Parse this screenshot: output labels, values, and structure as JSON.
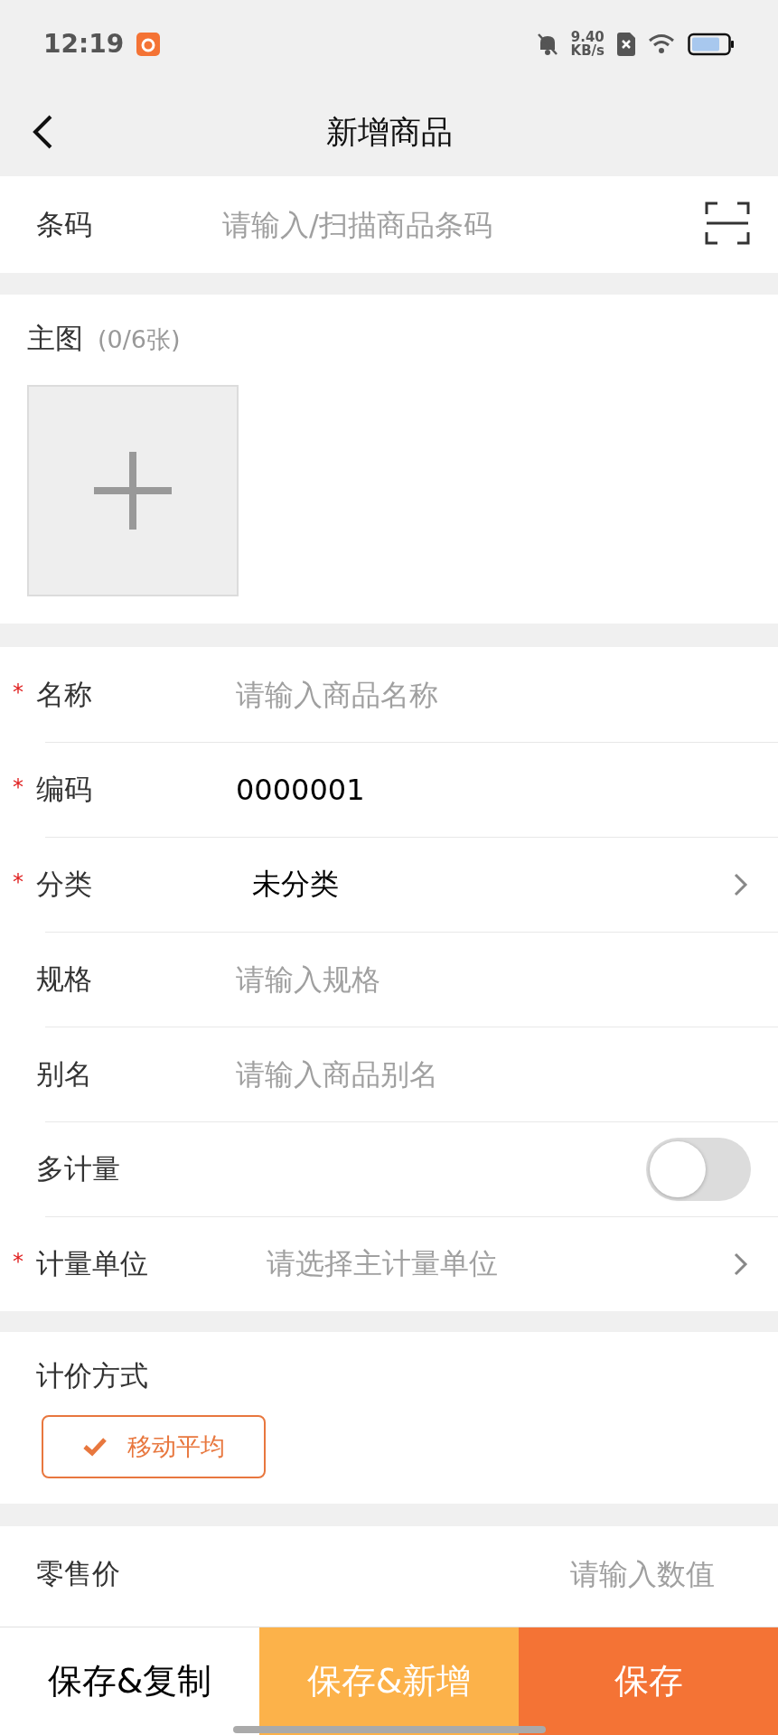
{
  "status_bar": {
    "time": "12:19",
    "net_speed": "9.40",
    "net_unit": "KB/s"
  },
  "header": {
    "title": "新增商品"
  },
  "barcode": {
    "label": "条码",
    "placeholder": "请输入/扫描商品条码"
  },
  "main_image": {
    "label": "主图",
    "count": "(0/6张)"
  },
  "fields": [
    {
      "label": "名称",
      "mark": "*",
      "kind": "input",
      "placeholder": "请输入商品名称"
    },
    {
      "label": "编码",
      "mark": "*",
      "kind": "input",
      "value": "0000001"
    },
    {
      "label": "分类",
      "mark": "*",
      "kind": "select",
      "value": "未分类"
    },
    {
      "label": "规格",
      "kind": "input",
      "placeholder": "请输入规格"
    },
    {
      "label": "别名",
      "kind": "input",
      "placeholder": "请输入商品别名"
    },
    {
      "label": "多计量",
      "kind": "toggle",
      "on": false
    },
    {
      "label": "计量单位",
      "mark": "*",
      "kind": "select",
      "placeholder": "请选择主计量单位"
    }
  ],
  "pricing": {
    "label": "计价方式",
    "options": [
      {
        "label": "移动平均",
        "selected": true
      }
    ]
  },
  "retail_price": {
    "label": "零售价",
    "placeholder": "请输入数值"
  },
  "actions": [
    {
      "label": "保存&复制",
      "kind": "plain"
    },
    {
      "label": "保存&新增",
      "kind": "secondary"
    },
    {
      "label": "保存",
      "kind": "primary"
    }
  ]
}
